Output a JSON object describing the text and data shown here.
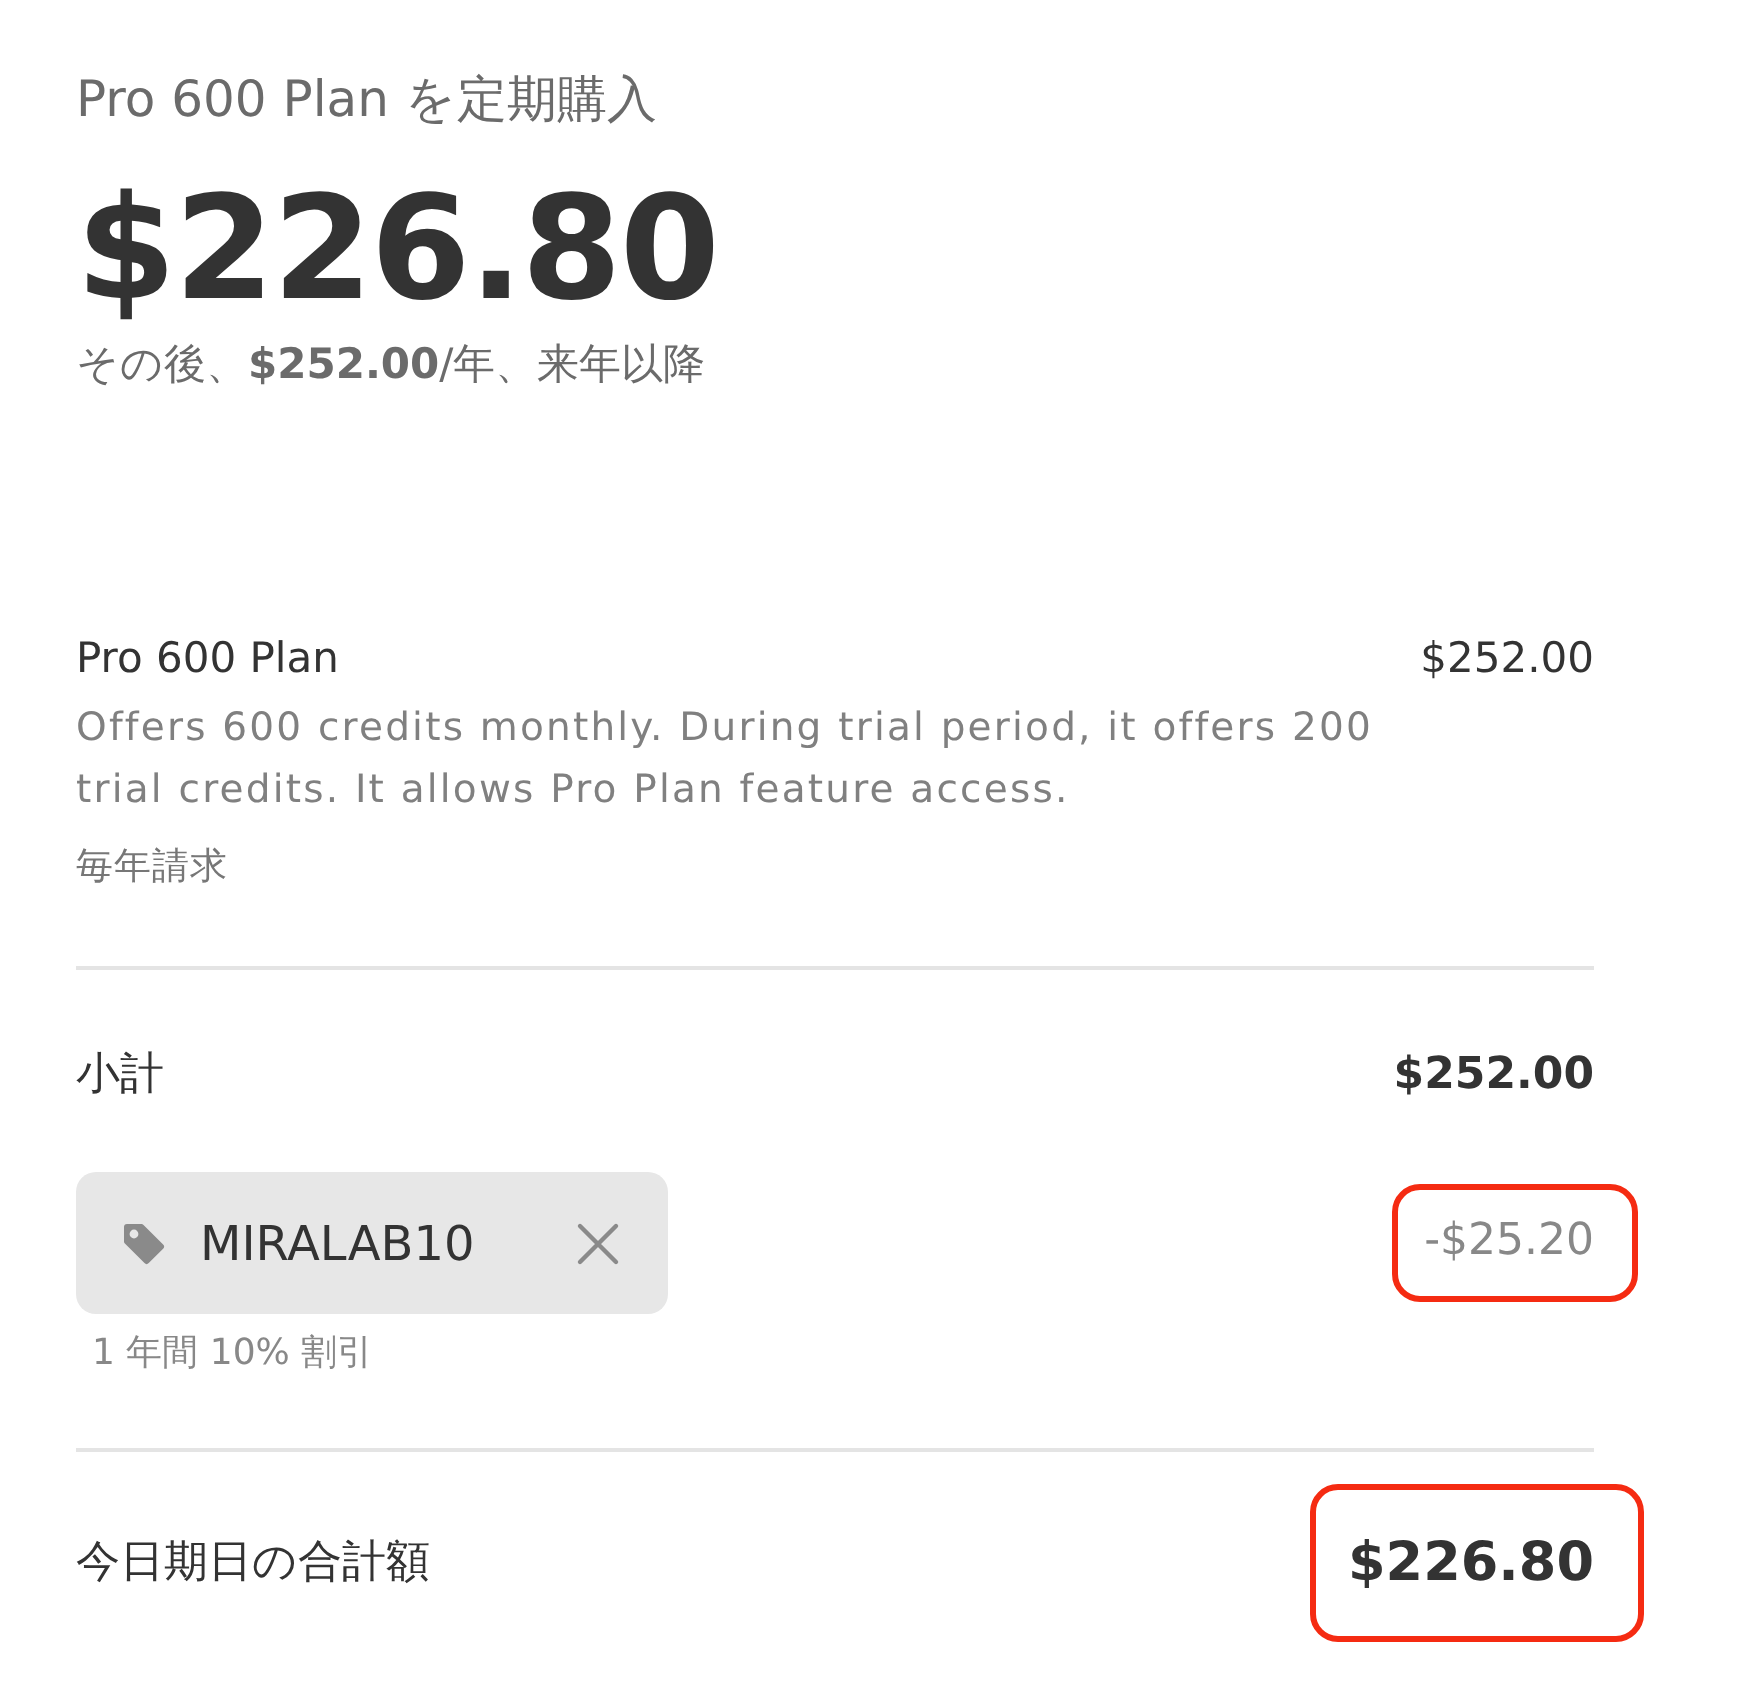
{
  "header": {
    "title": "Pro 600 Plan を定期購入",
    "price": "$226.80",
    "renewal_note": "その後、**$252.00**/年、来年以降"
  },
  "line_item": {
    "name": "Pro 600 Plan",
    "price": "$252.00",
    "description": "Offers 600 credits monthly. During trial period, it offers 200 trial credits. It allows Pro Plan feature access.",
    "billing": "毎年請求"
  },
  "subtotal": {
    "label": "小計",
    "amount": "$252.00"
  },
  "promo": {
    "code": "MIRALAB10",
    "note": "1 年間 10% 割引",
    "amount": "-$25.20",
    "highlighted": true
  },
  "total": {
    "label": "今日期日の合計額",
    "amount": "$226.80",
    "highlighted": true
  }
}
